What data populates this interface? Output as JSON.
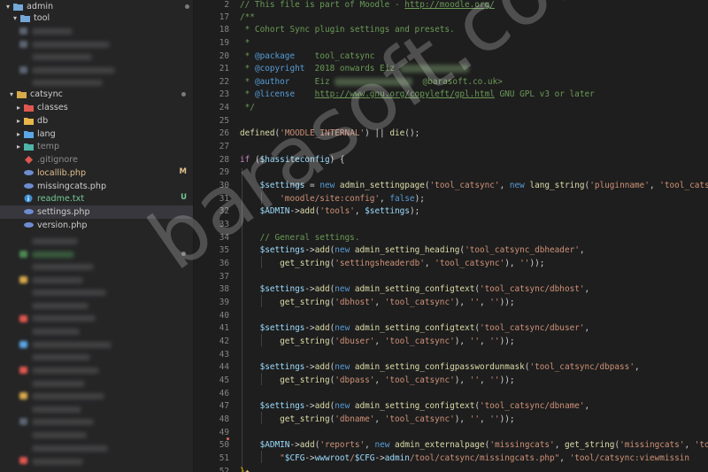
{
  "sidebar": {
    "admin_label": "admin",
    "tool_label": "tool",
    "catsync_label": "catsync",
    "items": [
      {
        "label": "classes",
        "status": ""
      },
      {
        "label": "db",
        "status": ""
      },
      {
        "label": "lang",
        "status": ""
      },
      {
        "label": "temp",
        "status": ""
      },
      {
        "label": ".gitignore",
        "status": ""
      },
      {
        "label": "locallib.php",
        "status": "M"
      },
      {
        "label": "missingcats.php",
        "status": ""
      },
      {
        "label": "readme.txt",
        "status": "U"
      },
      {
        "label": "settings.php",
        "status": ""
      },
      {
        "label": "version.php",
        "status": ""
      }
    ]
  },
  "editor": {
    "lines": [
      {
        "n": "2",
        "t": "// This file is part of Moodle - http://moodle.org/"
      },
      {
        "n": "17",
        "t": "/**"
      },
      {
        "n": "18",
        "t": " * Cohort Sync plugin settings and presets."
      },
      {
        "n": "19",
        "t": " *"
      },
      {
        "n": "20",
        "t": " * @package    tool_catsync"
      },
      {
        "n": "21",
        "t": " * @copyright  2018 onwards Eiz"
      },
      {
        "n": "22",
        "t": " * @author     Eiz  @barasoft.co.uk>"
      },
      {
        "n": "23",
        "t": " * @license    http://www.gnu.org/copyleft/gpl.html GNU GPL v3 or later"
      },
      {
        "n": "24",
        "t": " */"
      },
      {
        "n": "25",
        "t": ""
      },
      {
        "n": "26",
        "t": "defined('MOODLE_INTERNAL') || die();"
      },
      {
        "n": "27",
        "t": ""
      },
      {
        "n": "28",
        "t": "if ($hassiteconfig) {"
      },
      {
        "n": "29",
        "t": ""
      },
      {
        "n": "30",
        "t": "    $settings = new admin_settingpage('tool_catsync', new lang_string('pluginname', 'tool_cats"
      },
      {
        "n": "31",
        "t": "        'moodle/site:config', false);"
      },
      {
        "n": "32",
        "t": "    $ADMIN->add('tools', $settings);"
      },
      {
        "n": "33",
        "t": ""
      },
      {
        "n": "34",
        "t": "    // General settings."
      },
      {
        "n": "35",
        "t": "    $settings->add(new admin_setting_heading('tool_catsync_dbheader',"
      },
      {
        "n": "36",
        "t": "        get_string('settingsheaderdb', 'tool_catsync'), ''));"
      },
      {
        "n": "37",
        "t": ""
      },
      {
        "n": "38",
        "t": "    $settings->add(new admin_setting_configtext('tool_catsync/dbhost',"
      },
      {
        "n": "39",
        "t": "        get_string('dbhost', 'tool_catsync'), '', ''));"
      },
      {
        "n": "40",
        "t": ""
      },
      {
        "n": "41",
        "t": "    $settings->add(new admin_setting_configtext('tool_catsync/dbuser',"
      },
      {
        "n": "42",
        "t": "        get_string('dbuser', 'tool_catsync'), '', ''));"
      },
      {
        "n": "43",
        "t": ""
      },
      {
        "n": "44",
        "t": "    $settings->add(new admin_setting_configpasswordunmask('tool_catsync/dbpass',"
      },
      {
        "n": "45",
        "t": "        get_string('dbpass', 'tool_catsync'), '', ''));"
      },
      {
        "n": "46",
        "t": ""
      },
      {
        "n": "47",
        "t": "    $settings->add(new admin_setting_configtext('tool_catsync/dbname',"
      },
      {
        "n": "48",
        "t": "        get_string('dbname', 'tool_catsync'), '', ''));"
      },
      {
        "n": "49",
        "t": ""
      },
      {
        "n": "50",
        "t": "    $ADMIN->add('reports', new admin_externalpage('missingcats', get_string('missingcats', 'too"
      },
      {
        "n": "51",
        "t": "        \"$CFG->wwwroot/$CFG->admin/tool/catsync/missingcats.php\", 'tool/catsync:viewmissin"
      },
      {
        "n": "52",
        "t": "}"
      }
    ]
  },
  "watermark": "barasoft.co.uk",
  "colors": {
    "editor_bg": "#1e1e1e",
    "sidebar_bg": "#252526",
    "comment": "#6a9955",
    "string": "#ce9178",
    "keyword": "#c586c0",
    "function": "#dcdcaa",
    "variable": "#9cdcfe",
    "modified": "#e2c08d",
    "untracked": "#73c991"
  },
  "icons": {
    "folder": "folder-icon",
    "php_file": "php-file-icon",
    "text_file": "text-file-icon",
    "git_file": "git-file-icon"
  }
}
